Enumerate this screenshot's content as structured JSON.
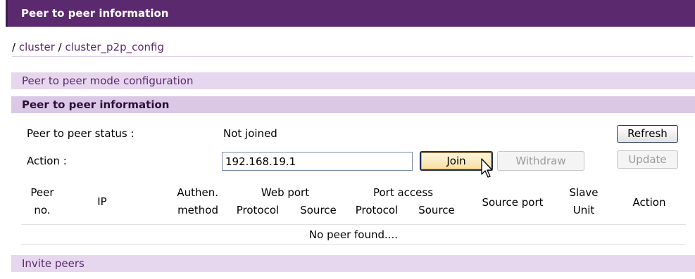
{
  "header": {
    "title": "Peer to peer information"
  },
  "breadcrumb": {
    "sep1": "/",
    "item1": "cluster",
    "sep2": "/",
    "item2": "cluster_p2p_config"
  },
  "sections": {
    "mode_config": "Peer to peer mode configuration",
    "info": "Peer to peer information",
    "invite": "Invite peers"
  },
  "status": {
    "label": "Peer to peer status :",
    "value": "Not joined"
  },
  "action": {
    "label": "Action :",
    "ip_value": "192.168.19.1"
  },
  "buttons": {
    "refresh": "Refresh",
    "join": "Join",
    "withdraw": "Withdraw",
    "update": "Update"
  },
  "table": {
    "peer_no": [
      "Peer",
      "no."
    ],
    "ip": "IP",
    "authen": [
      "Authen.",
      "method"
    ],
    "web_port": "Web port",
    "port_access": "Port access",
    "protocol1": "Protocol",
    "source1": "Source",
    "protocol2": "Protocol",
    "source2": "Source",
    "source_port": "Source port",
    "slave_unit": [
      "Slave",
      "Unit"
    ],
    "action": "Action",
    "empty": "No peer found...."
  }
}
